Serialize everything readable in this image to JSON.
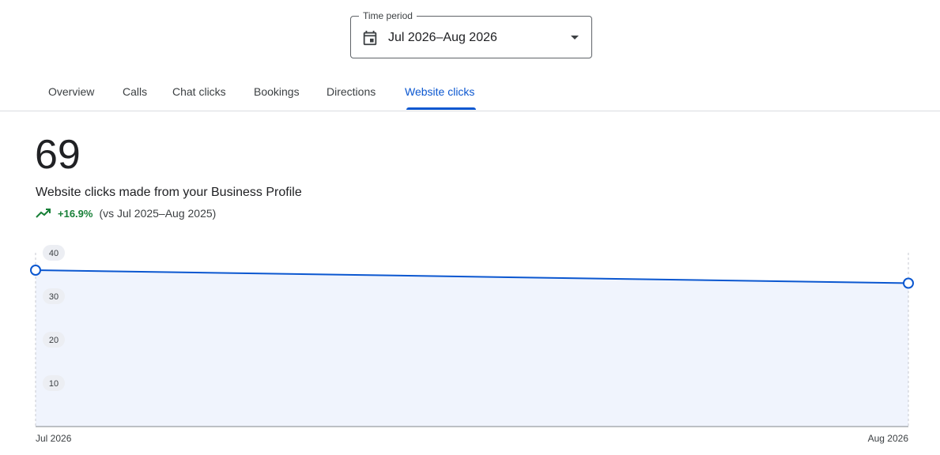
{
  "time_period": {
    "label": "Time period",
    "value": "Jul 2026–Aug 2026",
    "icon": "calendar-icon"
  },
  "tabs": [
    {
      "label": "Overview"
    },
    {
      "label": "Calls"
    },
    {
      "label": "Chat clicks"
    },
    {
      "label": "Bookings"
    },
    {
      "label": "Directions"
    },
    {
      "label": "Website clicks",
      "active": true
    }
  ],
  "metric": {
    "value": "69",
    "label": "Website clicks made from your Business Profile",
    "change": "+16.9%",
    "comparison": "(vs Jul 2025–Aug 2025)"
  },
  "colors": {
    "accent": "#0b57d0",
    "positive": "#188038",
    "area_fill": "#f0f4fd"
  },
  "chart_data": {
    "type": "area",
    "categories": [
      "Jul 2026",
      "Aug 2026"
    ],
    "series": [
      {
        "values": [
          36,
          33
        ]
      }
    ],
    "yticks": [
      10,
      20,
      30,
      40
    ],
    "ylim": [
      0,
      40
    ],
    "grid": false
  }
}
